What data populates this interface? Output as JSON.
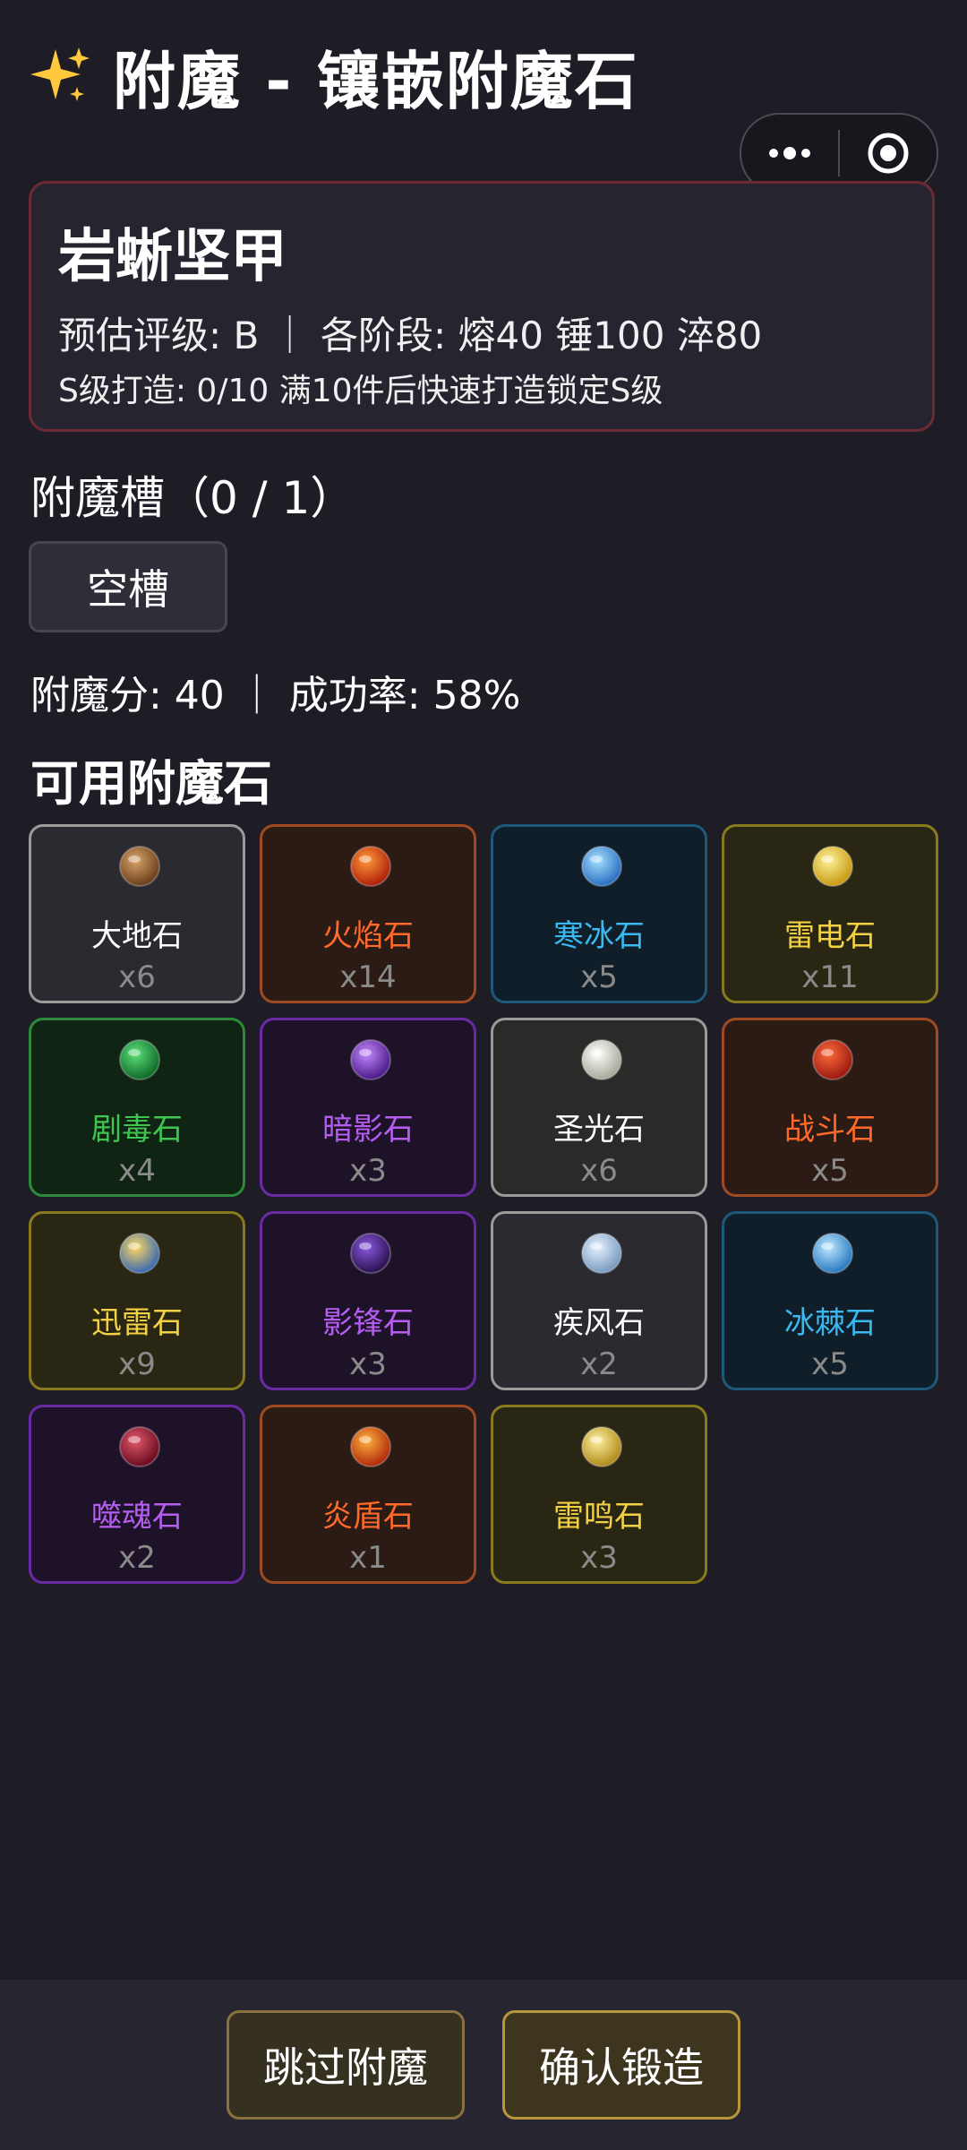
{
  "header": {
    "title": "附魔 - 镶嵌附魔石"
  },
  "item": {
    "name": "岩蜥坚甲",
    "line1": "预估评级: B ｜ 各阶段: 熔40 锤100 淬80",
    "line2": "S级打造: 0/10  满10件后快速打造锁定S级"
  },
  "slots": {
    "title": "附魔槽（0 / 1）",
    "empty_label": "空槽"
  },
  "stats": "附魔分: 40 ｜ 成功率: 58%",
  "available": {
    "title": "可用附魔石",
    "stones": [
      {
        "name": "大地石",
        "count": "x6",
        "border": "#9a9a9a",
        "bg": "#2b2a30",
        "text": "#ffffff",
        "c1": "#d9a56a",
        "c2": "#6b3e1c",
        "icon": "earth-stone-icon"
      },
      {
        "name": "火焰石",
        "count": "x14",
        "border": "#a04a22",
        "bg": "#2c1a14",
        "text": "#ff6a2a",
        "c1": "#ff9a3a",
        "c2": "#b0200a",
        "icon": "fire-stone-icon"
      },
      {
        "name": "寒冰石",
        "count": "x5",
        "border": "#1d5a7a",
        "bg": "#0f1e28",
        "text": "#3ab8f0",
        "c1": "#a6e0ff",
        "c2": "#2a6fc0",
        "icon": "ice-stone-icon"
      },
      {
        "name": "雷电石",
        "count": "x11",
        "border": "#8a7a1e",
        "bg": "#2a2614",
        "text": "#f2d244",
        "c1": "#fff29a",
        "c2": "#c89a12",
        "icon": "lightning-stone-icon"
      },
      {
        "name": "剧毒石",
        "count": "x4",
        "border": "#2c8a3a",
        "bg": "#102414",
        "text": "#3ec650",
        "c1": "#5ee07a",
        "c2": "#0f6a28",
        "icon": "poison-stone-icon"
      },
      {
        "name": "暗影石",
        "count": "x3",
        "border": "#6a2aa6",
        "bg": "#1e1228",
        "text": "#b45ef0",
        "c1": "#c48aff",
        "c2": "#4a1a8a",
        "icon": "shadow-stone-icon"
      },
      {
        "name": "圣光石",
        "count": "x6",
        "border": "#9a9a9a",
        "bg": "#2a2b28",
        "text": "#ffffff",
        "c1": "#ffffff",
        "c2": "#a8a89a",
        "icon": "holy-light-stone-icon"
      },
      {
        "name": "战斗石",
        "count": "x5",
        "border": "#a04a22",
        "bg": "#2c1a14",
        "text": "#ff6a2a",
        "c1": "#ff6a3a",
        "c2": "#9a1a10",
        "icon": "battle-stone-icon"
      },
      {
        "name": "迅雷石",
        "count": "x9",
        "border": "#8a7a1e",
        "bg": "#2a2614",
        "text": "#f2d244",
        "c1": "#ffd860",
        "c2": "#3a6ab0",
        "icon": "swift-thunder-stone-icon"
      },
      {
        "name": "影锋石",
        "count": "x3",
        "border": "#6a2aa6",
        "bg": "#1e1228",
        "text": "#b45ef0",
        "c1": "#8a5ae0",
        "c2": "#2a1050",
        "icon": "shadow-blade-stone-icon"
      },
      {
        "name": "疾风石",
        "count": "x2",
        "border": "#9a9a9a",
        "bg": "#2b2a30",
        "text": "#ffffff",
        "c1": "#e6f2ff",
        "c2": "#7a9ac0",
        "icon": "gale-stone-icon"
      },
      {
        "name": "冰棘石",
        "count": "x5",
        "border": "#1d5a7a",
        "bg": "#0f1e28",
        "text": "#3ab8f0",
        "c1": "#bfe8ff",
        "c2": "#2a7ac0",
        "icon": "ice-thorn-stone-icon"
      },
      {
        "name": "噬魂石",
        "count": "x2",
        "border": "#6a2aa6",
        "bg": "#1e1228",
        "text": "#b45ef0",
        "c1": "#e05a6a",
        "c2": "#6a0a20",
        "icon": "soul-devour-stone-icon"
      },
      {
        "name": "炎盾石",
        "count": "x1",
        "border": "#a04a22",
        "bg": "#2c1a14",
        "text": "#ff6a2a",
        "c1": "#ffb040",
        "c2": "#b02a0a",
        "icon": "flame-shield-stone-icon"
      },
      {
        "name": "雷鸣石",
        "count": "x3",
        "border": "#8a7a1e",
        "bg": "#2a2614",
        "text": "#f2d244",
        "c1": "#fff0a0",
        "c2": "#b08a1a",
        "icon": "thunder-roar-stone-icon"
      }
    ]
  },
  "buttons": {
    "skip": "跳过附魔",
    "confirm": "确认锻造"
  }
}
